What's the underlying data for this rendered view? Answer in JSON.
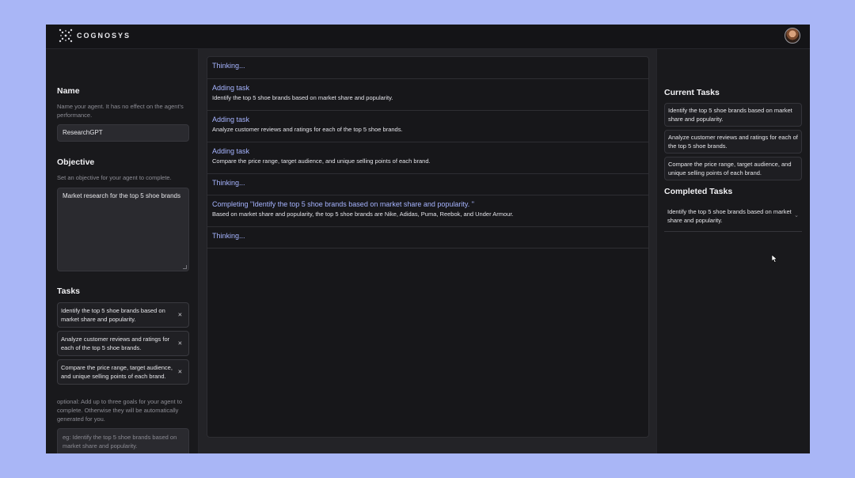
{
  "header": {
    "logo_text": "COGNOSYS"
  },
  "left": {
    "name_title": "Name",
    "name_hint": "Name your agent. It has no effect on the agent's performance.",
    "name_value": "ResearchGPT",
    "objective_title": "Objective",
    "objective_hint": "Set an objective for your agent to complete.",
    "objective_value": "Market research for the top 5 shoe brands",
    "tasks_title": "Tasks",
    "tasks": [
      "Identify the top 5 shoe brands based on market share and popularity.",
      "Analyze customer reviews and ratings for each of the top 5 shoe brands.",
      "Compare the price range, target audience, and unique selling points of each brand."
    ],
    "remove_glyph": "×",
    "tasks_hint": "optional: Add up to three goals for your agent to complete. Otherwise they will be automatically generated for you.",
    "new_task_placeholder": "eg: Identify the top 5 shoe brands based on market share and popularity."
  },
  "log": [
    {
      "head": "Thinking...",
      "body": ""
    },
    {
      "head": "Adding task",
      "body": "Identify the top 5 shoe brands based on market share and popularity."
    },
    {
      "head": "Adding task",
      "body": "Analyze customer reviews and ratings for each of the top 5 shoe brands."
    },
    {
      "head": "Adding task",
      "body": "Compare the price range, target audience, and unique selling points of each brand."
    },
    {
      "head": "Thinking...",
      "body": ""
    },
    {
      "head": "Completing \"Identify the top 5 shoe brands based on market share and popularity. \"",
      "body": "Based on market share and popularity, the top 5 shoe brands are Nike, Adidas, Puma, Reebok, and Under Armour."
    },
    {
      "head": "Thinking...",
      "body": ""
    }
  ],
  "right": {
    "current_title": "Current Tasks",
    "current": [
      "Identify the top 5 shoe brands based on market share and popularity.",
      "Analyze customer reviews and ratings for each of the top 5 shoe brands.",
      "Compare the price range, target audience, and unique selling points of each brand."
    ],
    "completed_title": "Completed Tasks",
    "completed": [
      "Identify the top 5 shoe brands based on market share and popularity."
    ]
  },
  "colors": {
    "accent": "#a6b4ff",
    "background": "#a9b6f6",
    "panel": "#19191c"
  }
}
